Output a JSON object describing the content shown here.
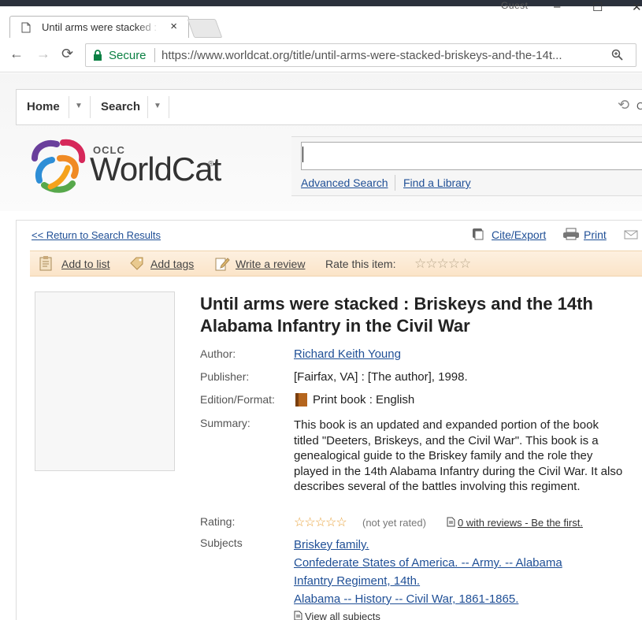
{
  "browser": {
    "tab_title": "Until arms were stacked :",
    "tab_close": "×",
    "profile": "Guest",
    "min": "–",
    "max": "☐",
    "close": "✕",
    "secure_label": "Secure",
    "url": "https://www.worldcat.org/title/until-arms-were-stacked-briskeys-and-the-14t..."
  },
  "menu": {
    "home": "Home",
    "search": "Search",
    "right_label": "C"
  },
  "logo": {
    "oclc": "OCLC",
    "name": "WorldCat",
    "reg": "®"
  },
  "search": {
    "value": "",
    "advanced_link": "Advanced Search",
    "find_library_link": "Find a Library"
  },
  "nav": {
    "return_link": "<< Return to Search Results",
    "cite_export": "Cite/Export",
    "print": "Print"
  },
  "actions": {
    "add_to_list": "Add to list",
    "add_tags": "Add tags",
    "write_review": "Write a review",
    "rate_label": "Rate this item:",
    "rate_stars": "☆☆☆☆☆"
  },
  "record": {
    "title": "Until arms were stacked : Briskeys and the 14th Alabama Infantry in the Civil War",
    "author_label": "Author:",
    "author": "Richard Keith Young",
    "publisher_label": "Publisher:",
    "publisher": "[Fairfax, VA] : [The author], 1998.",
    "edition_label": "Edition/Format:",
    "edition": "Print book : English",
    "summary_label": "Summary:",
    "summary": "This book is an updated and expanded portion of the book titled \"Deeters, Briskeys, and the Civil War\". This book is a genealogical guide to the Briskey family and the role they played in the 14th Alabama Infantry during the Civil War. It also describes several of the battles involving this regiment.",
    "rating_label": "Rating:",
    "rating_stars": "☆☆☆☆☆",
    "rating_text": "(not yet rated)",
    "reviews_link": "0 with reviews - Be the first.",
    "subjects_label": "Subjects",
    "subjects": [
      "Briskey family.",
      "Confederate States of America. -- Army. -- Alabama",
      "Infantry Regiment, 14th.",
      "Alabama -- History -- Civil War, 1861-1865."
    ],
    "view_all_subjects": "View all subjects"
  },
  "colors": {
    "link": "#1f4f96",
    "secure_green": "#0b8043",
    "star_orange": "#e8a33d",
    "action_bar": "#fbe4c8"
  }
}
